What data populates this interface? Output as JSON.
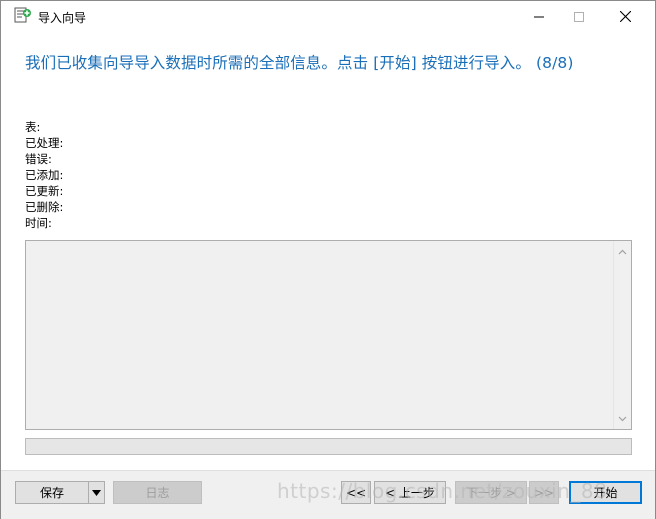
{
  "window": {
    "title": "导入向导",
    "controls": {
      "minimize": "—",
      "maximize": "☐",
      "close": "✕"
    }
  },
  "header": {
    "instruction": "我们已收集向导导入数据时所需的全部信息。点击 [开始] 按钮进行导入。 (8/8)"
  },
  "stats": {
    "table_label": "表:",
    "processed_label": "已处理:",
    "errors_label": "错误:",
    "added_label": "已添加:",
    "updated_label": "已更新:",
    "deleted_label": "已删除:",
    "time_label": "时间:"
  },
  "log": {
    "content": ""
  },
  "progress": {
    "value": 0
  },
  "footer": {
    "save_label": "保存",
    "log_label": "日志",
    "first_label": "<<",
    "back_label": "< 上一步",
    "next_label": "下一步 >",
    "last_label": ">>",
    "start_label": "开始"
  },
  "watermark": "https://blog.csdn.net/zouxin_88",
  "icons": {
    "app": "import-wizard-icon",
    "split_dropdown": "dropdown-arrow-icon",
    "scroll_up": "scroll-up-icon",
    "scroll_down": "scroll-down-icon"
  },
  "colors": {
    "header_text": "#1b6fb8",
    "accent_border": "#0078d7"
  }
}
